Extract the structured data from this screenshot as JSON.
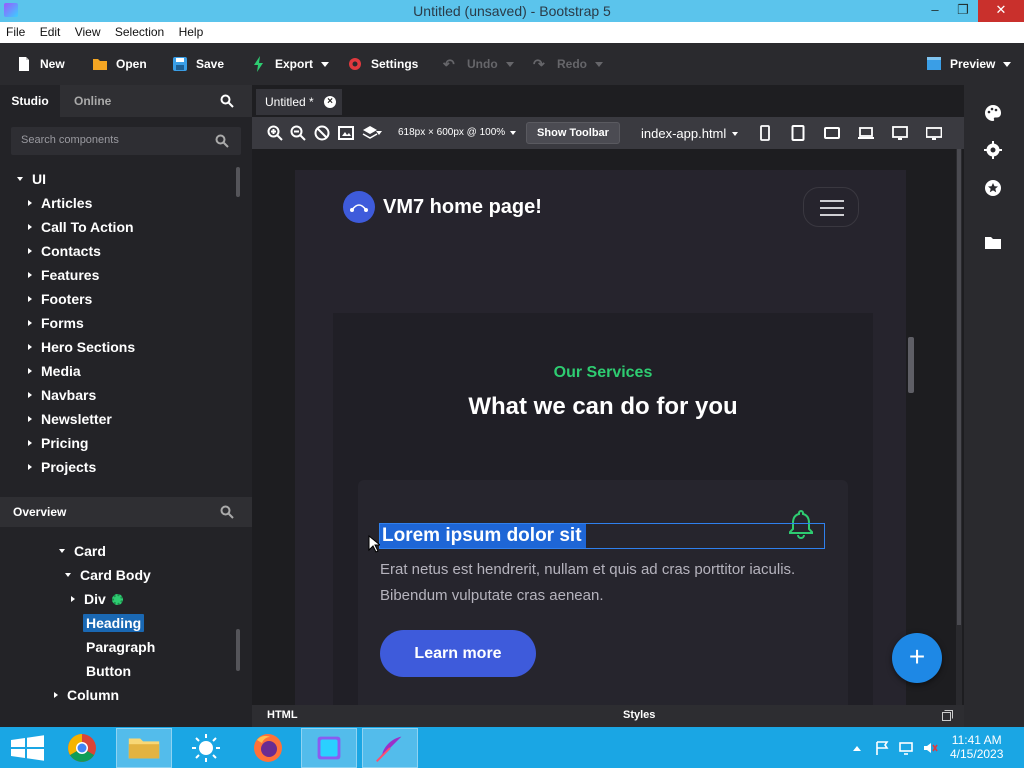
{
  "window": {
    "title": "Untitled (unsaved) - Bootstrap 5",
    "controls": {
      "minimize": "–",
      "maximize": "❐",
      "close": "✕"
    }
  },
  "menu": [
    "File",
    "Edit",
    "View",
    "Selection",
    "Help"
  ],
  "toolbar": {
    "new": "New",
    "open": "Open",
    "save": "Save",
    "export": "Export",
    "settings": "Settings",
    "undo": "Undo",
    "redo": "Redo",
    "preview": "Preview"
  },
  "left_panel": {
    "tabs": {
      "studio": "Studio",
      "online": "Online"
    },
    "search_placeholder": "Search components",
    "tree_root": "UI",
    "categories": [
      "Articles",
      "Call To Action",
      "Contacts",
      "Features",
      "Footers",
      "Forms",
      "Hero Sections",
      "Media",
      "Navbars",
      "Newsletter",
      "Pricing",
      "Projects"
    ],
    "overview": {
      "title": "Overview",
      "items": [
        "Card",
        "Card Body",
        "Div",
        "Heading",
        "Paragraph",
        "Button",
        "Column"
      ],
      "selected": "Heading"
    }
  },
  "editor": {
    "tab": "Untitled *",
    "tab_close": "×",
    "viewport_info": "618px × 600px @ 100%",
    "show_toolbar": "Show Toolbar",
    "page_file": "index-app.html"
  },
  "preview_page": {
    "brand": "VM7 home page!",
    "eyebrow": "Our Services",
    "heading": "What we can do for you",
    "card_title": "Lorem ipsum dolor sit",
    "card_text": "Erat netus est hendrerit, nullam et quis ad cras porttitor iaculis. Bibendum vulputate cras aenean.",
    "card_button": "Learn more",
    "fab": "+"
  },
  "bottom_tabs": {
    "html": "HTML",
    "styles": "Styles"
  },
  "taskbar": {
    "time": "11:41 AM",
    "date": "4/15/2023",
    "apps": [
      "start-icon",
      "chrome-icon",
      "file-explorer-icon",
      "weather-icon",
      "firefox-icon",
      "bootstrap-studio-icon",
      "feather-icon"
    ]
  },
  "colors": {
    "accent_blue": "#3e5bdb",
    "accent_green": "#2ecc71",
    "selection_blue": "#1a68b3",
    "title_bar": "#5bc4ec",
    "taskbar": "#1aa6e4"
  }
}
